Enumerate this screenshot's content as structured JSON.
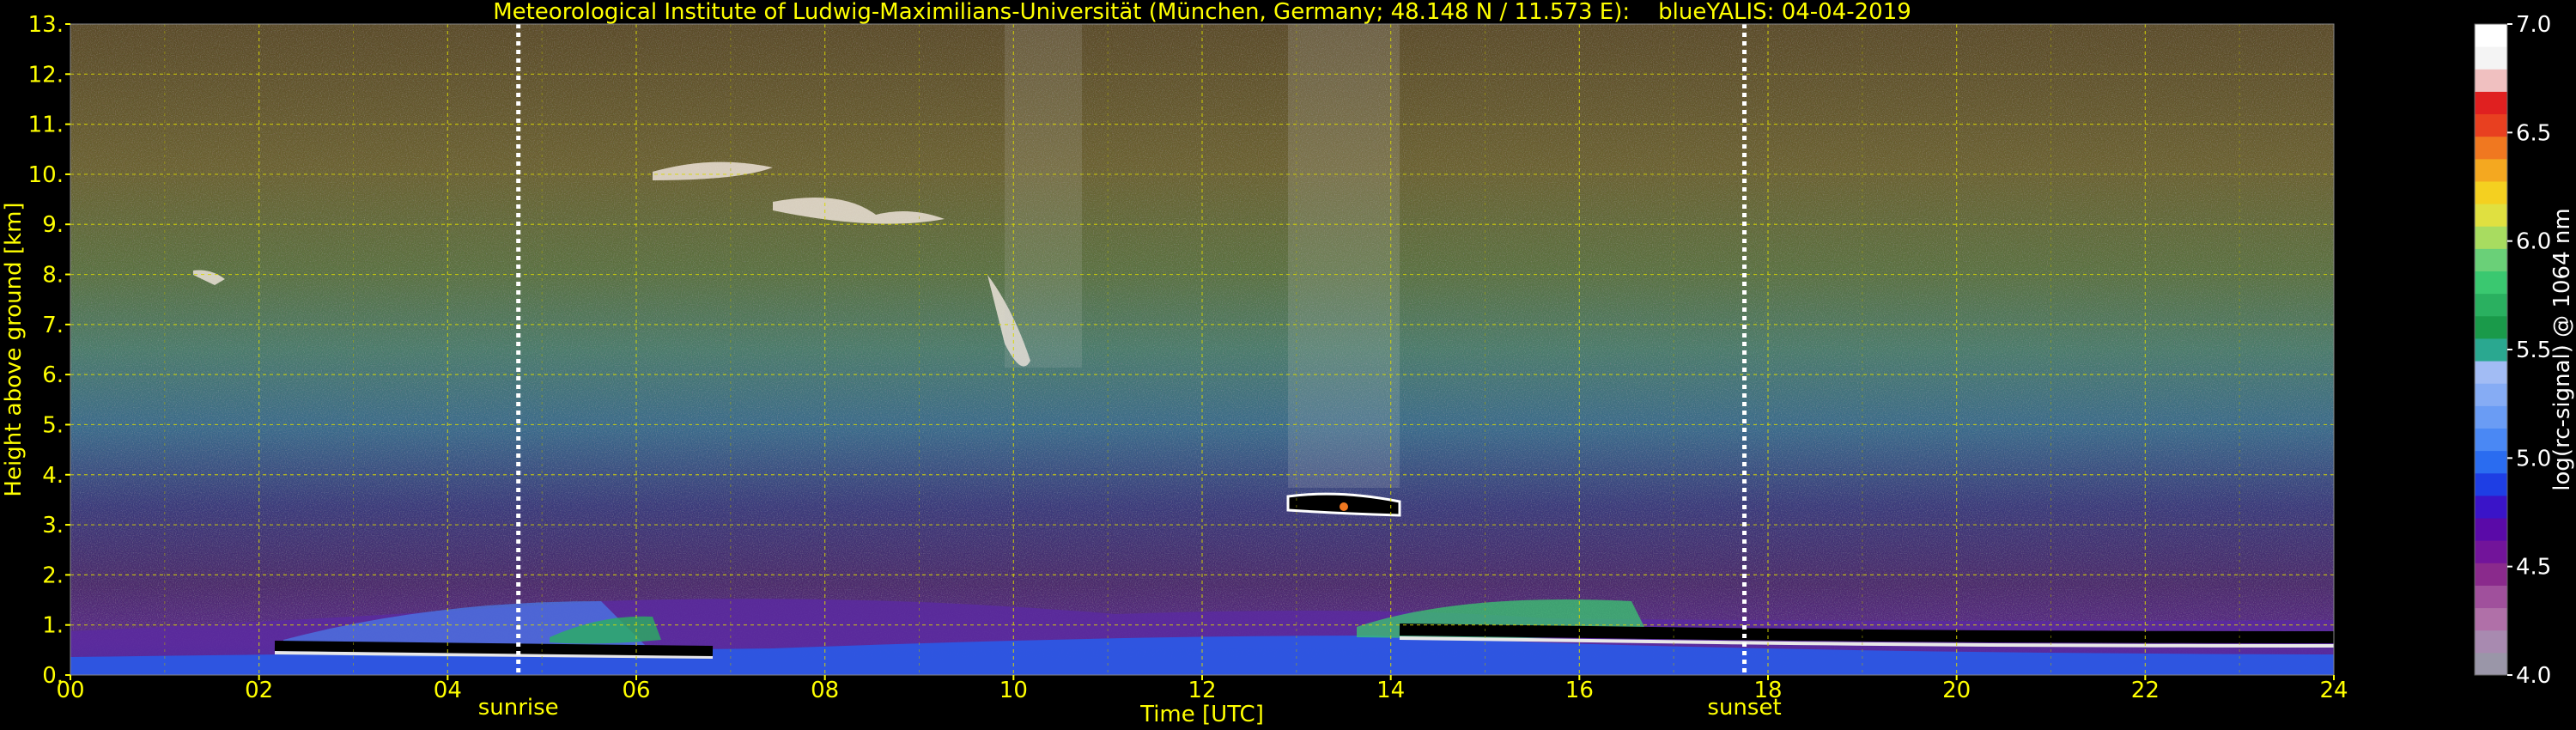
{
  "chart_data": {
    "type": "heatmap",
    "title": "Meteorological Institute of Ludwig-Maximilians-Universität (München, Germany; 48.148 N / 11.573 E):    blueYALIS: 04-04-2019",
    "xlabel": "Time [UTC]",
    "ylabel": "Height above ground [km]",
    "xlim": [
      0,
      24
    ],
    "ylim": [
      0,
      13
    ],
    "x_tick_labels": [
      "00",
      "02",
      "04",
      "06",
      "08",
      "10",
      "12",
      "14",
      "16",
      "18",
      "20",
      "22",
      "24"
    ],
    "y_tick_labels": [
      "0.",
      "1.",
      "2.",
      "3.",
      "4.",
      "5.",
      "6.",
      "7.",
      "8.",
      "9.",
      "10.",
      "11.",
      "12.",
      "13."
    ],
    "grid": true,
    "markers": [
      {
        "label": "sunrise",
        "x": 4.75
      },
      {
        "label": "sunset",
        "x": 17.75
      }
    ],
    "colorbar": {
      "label": "log(rc-signal) @ 1064 nm",
      "range": [
        4.0,
        7.0
      ],
      "tick_labels": [
        "4.0",
        "4.5",
        "5.0",
        "5.5",
        "6.0",
        "6.5",
        "7.0"
      ],
      "colors": [
        "#9a96a8",
        "#a88ab0",
        "#b070a8",
        "#a0509c",
        "#8a2a8c",
        "#72149a",
        "#5a0aa8",
        "#3a14c8",
        "#1e3ee4",
        "#2a6cf0",
        "#4a88f4",
        "#6a9cf4",
        "#86acf4",
        "#a2bcf4",
        "#2aa890",
        "#1a9a4a",
        "#2ab060",
        "#3ac870",
        "#6ad078",
        "#a8dc60",
        "#e0e040",
        "#f4d020",
        "#f4a820",
        "#f07820",
        "#e84020",
        "#e02020",
        "#f0c0c0",
        "#f4f4f4",
        "#ffffff"
      ]
    }
  }
}
